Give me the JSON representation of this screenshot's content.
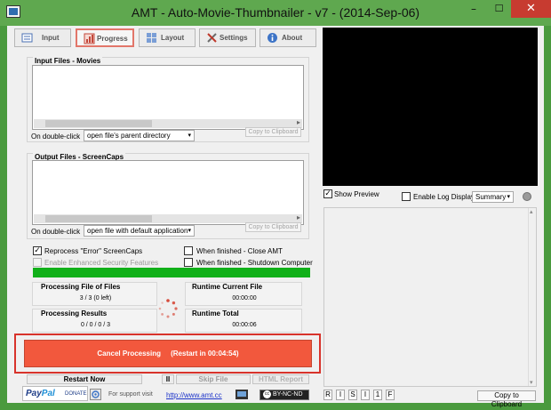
{
  "window": {
    "title": "AMT - Auto-Movie-Thumbnailer - v7 - (2014-Sep-06)",
    "minimize_glyph": "–",
    "maximize_glyph": "☐",
    "close_glyph": "✕"
  },
  "tabs": [
    {
      "label": "Input",
      "icon": "input-icon",
      "active": false
    },
    {
      "label": "Progress",
      "icon": "progress-icon",
      "active": true
    },
    {
      "label": "Layout",
      "icon": "layout-icon",
      "active": false
    },
    {
      "label": "Settings",
      "icon": "settings-icon",
      "active": false
    },
    {
      "label": "About",
      "icon": "about-icon",
      "active": false
    }
  ],
  "input_files": {
    "title": "Input Files - Movies",
    "double_click_label": "On double-click",
    "double_click_value": "open file's parent directory",
    "copy_label": "Copy to Clipboard"
  },
  "output_files": {
    "title": "Output Files - ScreenCaps",
    "double_click_label": "On double-click",
    "double_click_value": "open file with default application",
    "copy_label": "Copy to Clipboard"
  },
  "options": {
    "reprocess_error": {
      "label": "Reprocess \"Error\" ScreenCaps",
      "checked": true
    },
    "enhanced_security": {
      "label": "Enable Enhanced Security Features",
      "checked": false,
      "disabled": true
    },
    "close_amt": {
      "label": "When finished - Close AMT",
      "checked": false
    },
    "shutdown": {
      "label": "When finished - Shutdown Computer",
      "checked": false
    }
  },
  "progress": {
    "fraction": 1.0,
    "color": "#11b019"
  },
  "stats": {
    "file_of_files": {
      "title": "Processing File of Files",
      "value": "3 / 3 (0 left)"
    },
    "results": {
      "title": "Processing Results",
      "value": "0 / 0 / 0 / 3"
    },
    "runtime_current": {
      "title": "Runtime Current File",
      "value": "00:00:00"
    },
    "runtime_total": {
      "title": "Runtime Total",
      "value": "00:00:06"
    }
  },
  "cancel_button": {
    "label": "Cancel Processing     (Restart in 00:04:54)",
    "color": "#f2583d"
  },
  "bottom_buttons": {
    "restart_now": "Restart Now",
    "pause": "II",
    "skip_file": "Skip File",
    "html_report": "HTML Report"
  },
  "preview": {
    "show_preview": {
      "label": "Show Preview",
      "checked": true
    },
    "enable_log": {
      "label": "Enable Log Display",
      "checked": false
    },
    "log_level": "Summary"
  },
  "footer": {
    "paypal_pay": "Pay",
    "paypal_pal": "Pal",
    "paypal_donate": "DONATE",
    "support_text": "For support visit",
    "support_link": "http://www.amt.cc",
    "cc_badge": "BY-NC-ND",
    "cc_symbol": "cc",
    "flags": [
      "R",
      "I",
      "S",
      "I",
      "1",
      "F"
    ],
    "copy_clipboard": "Copy to Clipboard"
  }
}
